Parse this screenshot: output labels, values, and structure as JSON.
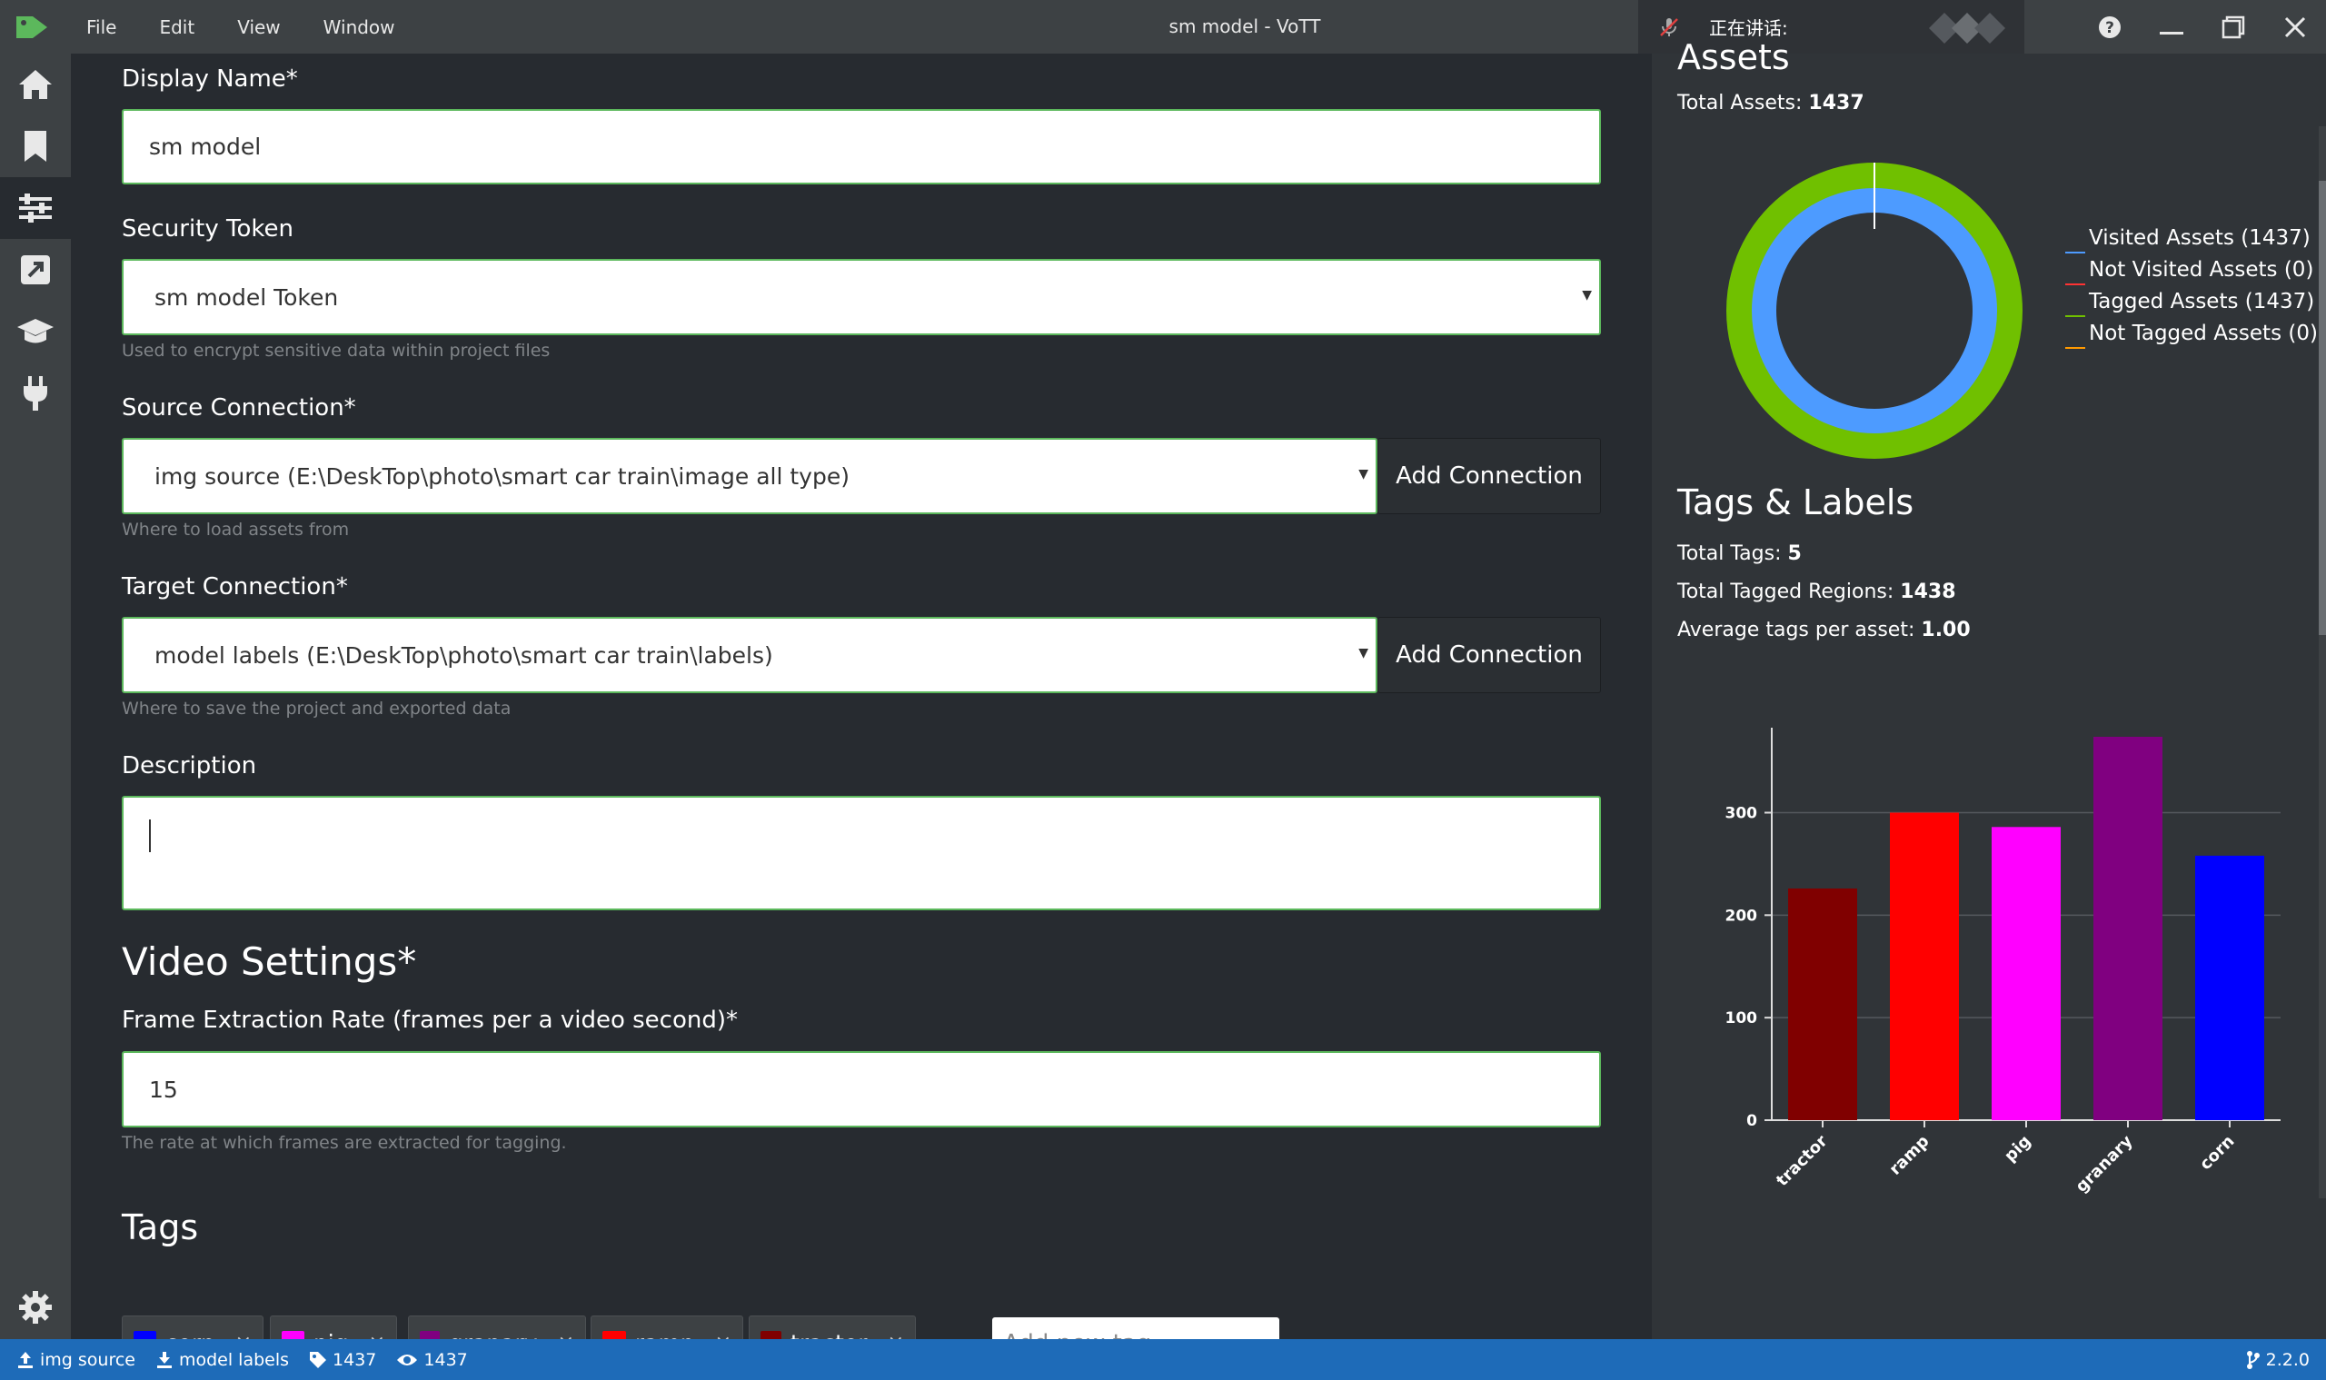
{
  "menu": [
    "File",
    "Edit",
    "View",
    "Window"
  ],
  "window_title": "sm model - VoTT",
  "speaking_label": "正在讲话:",
  "form": {
    "display_name_label": "Display Name*",
    "display_name_value": "sm model",
    "security_token_label": "Security Token",
    "security_token_value": "sm model Token",
    "security_token_help": "Used to encrypt sensitive data within project files",
    "source_label": "Source Connection*",
    "source_value": "img source (E:\\DeskTop\\photo\\smart car train\\image all type)",
    "source_help": "Where to load assets from",
    "target_label": "Target Connection*",
    "target_value": "model labels (E:\\DeskTop\\photo\\smart car train\\labels)",
    "target_help": "Where to save the project and exported data",
    "add_connection": "Add Connection",
    "description_label": "Description",
    "video_settings_title": "Video Settings*",
    "frame_rate_label": "Frame Extraction Rate (frames per a video second)*",
    "frame_rate_value": "15",
    "frame_rate_help": "The rate at which frames are extracted for tagging.",
    "tags_title": "Tags",
    "tags": [
      {
        "name": "corn",
        "color": "#0000ff"
      },
      {
        "name": "pig",
        "color": "#ff00ff"
      },
      {
        "name": "granary",
        "color": "#800080"
      },
      {
        "name": "ramp",
        "color": "#ff0000"
      },
      {
        "name": "tractor",
        "color": "#800000"
      }
    ],
    "add_tag_placeholder": "Add new tag",
    "remove_glyph": "×"
  },
  "assets": {
    "title": "Assets",
    "total_label": "Total Assets:",
    "total_value": "1437",
    "legend": [
      {
        "label": "Visited Assets (1437)",
        "color": "#4d9bff"
      },
      {
        "label": "Not Visited Assets (0)",
        "color": "#ff3333"
      },
      {
        "label": "Tagged Assets (1437)",
        "color": "#70c000"
      },
      {
        "label": "Not Tagged Assets (0)",
        "color": "#ff9900"
      }
    ]
  },
  "tags_labels": {
    "title": "Tags & Labels",
    "total_tags_label": "Total Tags:",
    "total_tags_value": "5",
    "total_regions_label": "Total Tagged Regions:",
    "total_regions_value": "1438",
    "avg_label": "Average tags per asset:",
    "avg_value": "1.00"
  },
  "chart_data": [
    {
      "type": "pie",
      "rings": [
        {
          "name": "Visited",
          "values": [
            1437,
            0
          ],
          "colors": [
            "#4d9bff",
            "#ff3333"
          ]
        },
        {
          "name": "Tagged",
          "values": [
            1437,
            0
          ],
          "colors": [
            "#70c000",
            "#ff9900"
          ]
        }
      ]
    },
    {
      "type": "bar",
      "categories": [
        "tractor",
        "ramp",
        "pig",
        "granary",
        "corn"
      ],
      "values": [
        226,
        300,
        286,
        374,
        258
      ],
      "colors": [
        "#800000",
        "#ff0000",
        "#ff00ff",
        "#800080",
        "#0000ff"
      ],
      "ylim": [
        0,
        374
      ],
      "yticks": [
        0,
        100,
        200,
        300
      ]
    }
  ],
  "statusbar": {
    "source": "img source",
    "target": "model labels",
    "tagged_count": "1437",
    "visited_count": "1437",
    "version": "2.2.0"
  },
  "icons": [
    "logo-icon",
    "home-icon",
    "bookmark-icon",
    "settings-sliders-icon",
    "export-icon",
    "graduation-cap-icon",
    "plug-icon",
    "gear-icon",
    "help-icon",
    "minimize-icon",
    "restore-icon",
    "close-icon"
  ]
}
